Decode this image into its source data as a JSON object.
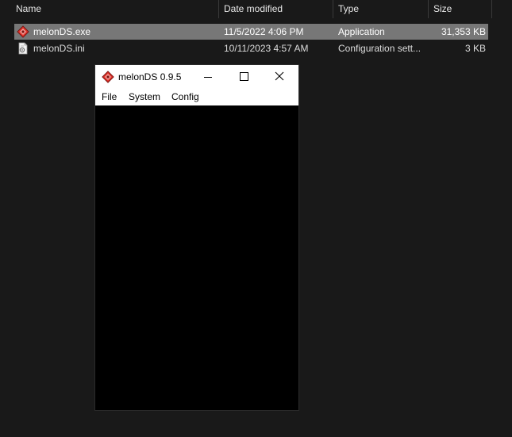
{
  "explorer": {
    "columns": {
      "name": "Name",
      "date": "Date modified",
      "type": "Type",
      "size": "Size"
    },
    "sort_indicator": "^",
    "files": [
      {
        "name": "melonDS.exe",
        "date": "11/5/2022 4:06 PM",
        "type": "Application",
        "size": "31,353 KB",
        "icon": "melonds-app-icon",
        "selected": true
      },
      {
        "name": "melonDS.ini",
        "date": "10/11/2023 4:57 AM",
        "type": "Configuration sett...",
        "size": "3 KB",
        "icon": "config-file-icon",
        "selected": false
      }
    ],
    "colors": {
      "background": "#191919",
      "selected_row": "#777777",
      "text": "#dedede"
    }
  },
  "app_window": {
    "title": "melonDS 0.9.5",
    "menu": [
      "File",
      "System",
      "Config"
    ],
    "controls": {
      "minimize": "minimize-icon",
      "maximize": "maximize-icon",
      "close": "close-icon"
    },
    "colors": {
      "titlebar": "#ffffff",
      "screen": "#000000",
      "icon_accent": "#e2342c"
    }
  }
}
